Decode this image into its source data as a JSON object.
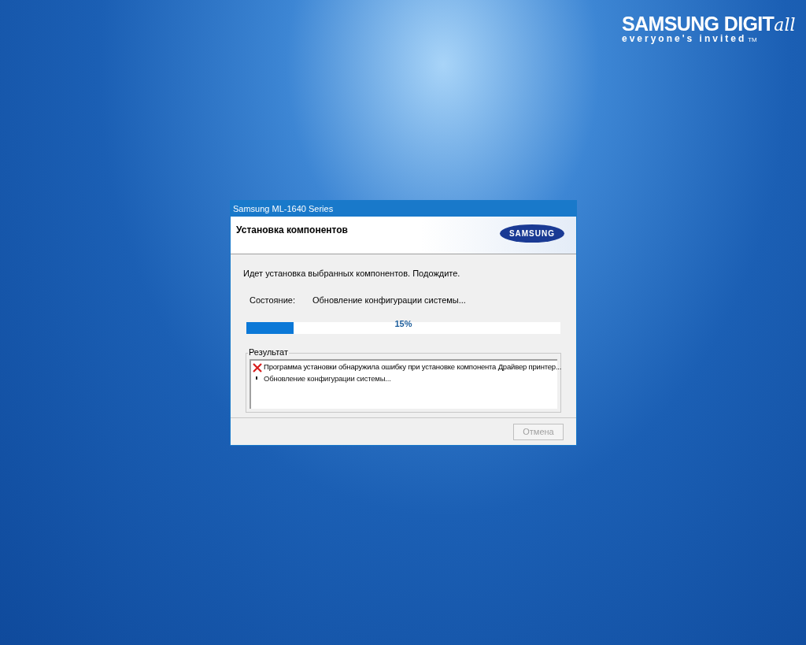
{
  "brand": {
    "name": "SAMSUNG DIGIT",
    "suffix": "all",
    "tagline": "everyone's invited",
    "tm": "TM"
  },
  "window": {
    "title": "Samsung ML-1640 Series"
  },
  "header": {
    "title": "Установка компонентов",
    "logo": "SAMSUNG"
  },
  "message": "Идет установка выбранных компонентов. Подождите.",
  "status": {
    "label": "Состояние:",
    "value": "Обновление конфигурации системы..."
  },
  "progress": {
    "level": 0.15,
    "reading": "15%"
  },
  "result": {
    "label": "Результат",
    "entries": [
      {
        "kind": "error",
        "text": "Программа установки обнаружила ошибку при установке компонента Драйвер принтер..."
      },
      {
        "kind": "info",
        "text": "Обновление конфигурации системы..."
      }
    ]
  },
  "buttons": [
    {
      "label": "Отмена",
      "disabled": true
    }
  ]
}
